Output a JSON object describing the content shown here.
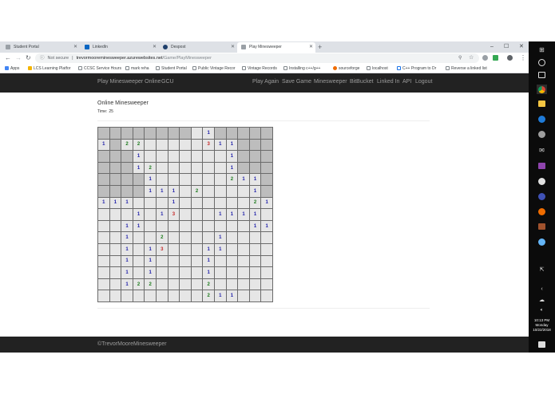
{
  "browser": {
    "tabs": [
      {
        "title": "Student Portal",
        "active": false
      },
      {
        "title": "LinkedIn",
        "active": false
      },
      {
        "title": "Despost",
        "active": false
      },
      {
        "title": "Play Minesweeper",
        "active": true
      }
    ],
    "new_tab_glyph": "+",
    "window_controls": [
      "–",
      "☐",
      "✕"
    ],
    "security_text": "Not secure",
    "url_host": "trevormooreminesweeper.azurewebsites.net",
    "url_path": "/Game/PlayMinesweeper",
    "bookmarks": [
      "Apps",
      "LCS Learning Platfor",
      "CCSC Service Hours",
      "mark reha",
      "Student Portal",
      "Public Vintage Recor",
      "Vintage Records",
      "Installing c++/g++",
      "sourceforge",
      "localhost",
      "C++ Program to Dr",
      "Reverse a linked list"
    ]
  },
  "site": {
    "brand": "Play Minesweeper Online",
    "brand2": "GCU",
    "nav": [
      "Play Again",
      "Save Game",
      "Minesweeper",
      "BitBucket",
      "Linked In",
      "API",
      "Logout"
    ],
    "page_title": "Online Minesweeper",
    "time_label": "Time:",
    "time_value": "25",
    "footer": "©TrevorMooreMinesweeper"
  },
  "game": {
    "number_colors": {
      "1": "#1a1aa8",
      "2": "#1b7a1b",
      "3": "#c62828"
    },
    "board": [
      "HHHHHHHHR1HHHHH",
      "1H22RRRRR311HHH",
      "HHH1RRRRRRR1HHH",
      "HHH12RRRRRR1HHH",
      "HHHH1RRRRRR211H",
      "HHHH111R2RRRR1H",
      "111RRR1RRRRRR21",
      "RRR1R13RRR1111R",
      "RR11RRRRRRRRR11",
      "RR1RR2RRRR1RRRR",
      "RR1R13RRR11RRRR",
      "RR1R1RRRR1RRRRR",
      "RR1R1RRRR1RRRRR",
      "RR122RRRR2RRRRR",
      "RRRRRRRRR211RRR"
    ]
  },
  "taskbar": {
    "time": "10:13 PM",
    "day": "Monday",
    "date": "10/22/2018"
  },
  "colors": {
    "navbar": "#222222",
    "nav_text": "#9d9d9d",
    "hidden_cell": "#bdbdbd",
    "revealed_cell": "#e6e6e6"
  }
}
